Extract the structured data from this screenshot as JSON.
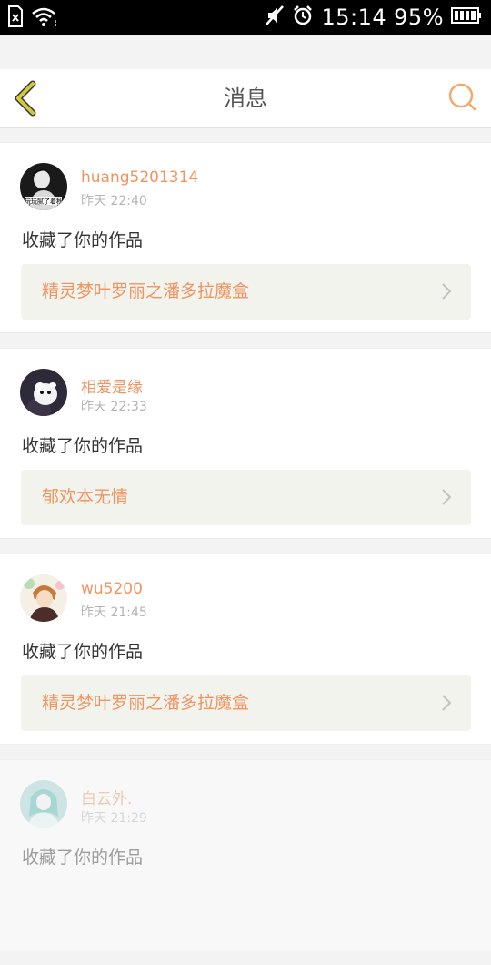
{
  "status_bar": {
    "time": "15:14",
    "battery_percent": "95%"
  },
  "header": {
    "title": "消息"
  },
  "colors": {
    "accent": "#f09460",
    "back_icon": "#d2c93d",
    "search_icon": "#f4a86a"
  },
  "messages": [
    {
      "username": "huang5201314",
      "time": "昨天 22:40",
      "action": "收藏了你的作品",
      "work_title": "精灵梦叶罗丽之潘多拉魔盒",
      "avatar_caption": "玩玩腻了着秋"
    },
    {
      "username": "相爱是缘",
      "time": "昨天 22:33",
      "action": "收藏了你的作品",
      "work_title": "郁欢本无情"
    },
    {
      "username": "wu5200",
      "time": "昨天 21:45",
      "action": "收藏了你的作品",
      "work_title": "精灵梦叶罗丽之潘多拉魔盒"
    },
    {
      "username": "白云外.",
      "time": "昨天 21:29",
      "action": "收藏了你的作品"
    }
  ]
}
